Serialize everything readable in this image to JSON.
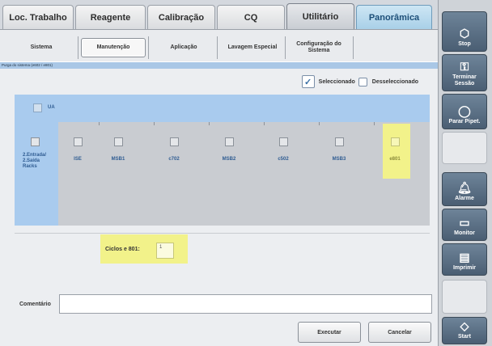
{
  "top_tabs": [
    {
      "label": "Loc. Trabalho"
    },
    {
      "label": "Reagente"
    },
    {
      "label": "Calibração"
    },
    {
      "label": "CQ"
    },
    {
      "label": "Utilitário"
    },
    {
      "label": "Panorâmica"
    }
  ],
  "sub_tabs": [
    {
      "label": "Sistema"
    },
    {
      "label": "Manutenção"
    },
    {
      "label": "Aplicação"
    },
    {
      "label": "Lavagem Especial"
    },
    {
      "label": "Configuração do Sistema"
    }
  ],
  "panel_title": "Purga do sistema (e602 / e801)",
  "legend": {
    "selected_label": "Seleccionado",
    "deselected_label": "Desseleccionado"
  },
  "ua_label": "UA",
  "modules": [
    {
      "label": "2.Entrada/ 2.Saída Racks"
    },
    {
      "label": "ISE"
    },
    {
      "label": "MSB1"
    },
    {
      "label": "c702"
    },
    {
      "label": "MSB2"
    },
    {
      "label": "c502"
    },
    {
      "label": "MSB3"
    },
    {
      "label": "e801"
    }
  ],
  "cycles": {
    "label": "Ciclos e 801:",
    "value": "1"
  },
  "comment": {
    "label": "Comentário",
    "value": ""
  },
  "buttons": {
    "execute": "Executar",
    "cancel": "Cancelar"
  },
  "sidebar": {
    "stop": "Stop",
    "logout": "Terminar Sessão",
    "stop_pipetting": "Parar Pipet.",
    "alarm": "Alarme",
    "monitor": "Monitor",
    "print": "Imprimir",
    "start": "Start"
  },
  "colors": {
    "ua_row": "#a9cbee",
    "highlight": "#f2f28a",
    "sidebar_button": "#4a5e73"
  }
}
